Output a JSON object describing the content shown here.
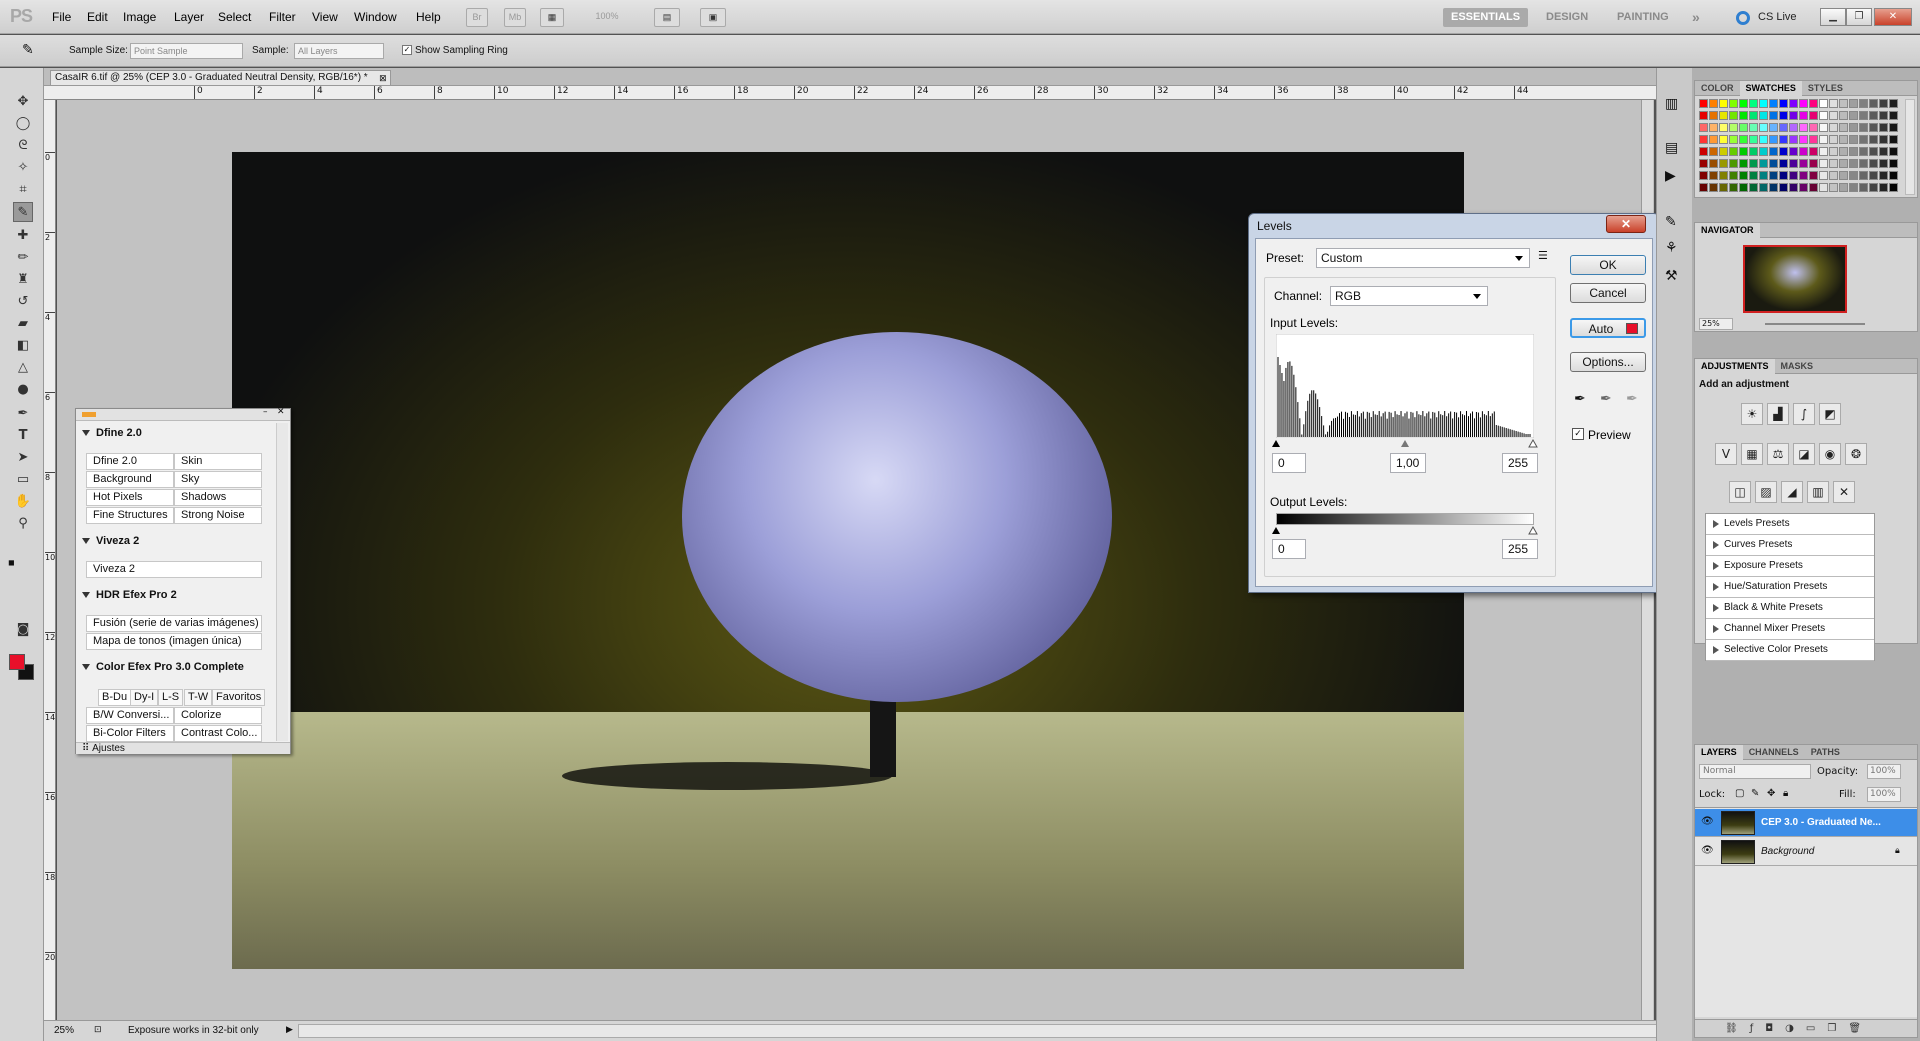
{
  "app": {
    "logo": "PS"
  },
  "menu": [
    "File",
    "Edit",
    "Image",
    "Layer",
    "Select",
    "Filter",
    "View",
    "Window",
    "Help"
  ],
  "menubar_buttons": {
    "br": "Br",
    "mb": "Mb",
    "zoom": "100%"
  },
  "workspaces": {
    "essentials": "ESSENTIALS",
    "design": "DESIGN",
    "painting": "PAINTING",
    "more": "»",
    "cslive": "CS Live"
  },
  "options": {
    "sample_size_label": "Sample Size:",
    "sample_size_value": "Point Sample",
    "sample_label": "Sample:",
    "sample_value": "All Layers",
    "show_ring_label": "Show Sampling Ring",
    "show_ring_checked": true
  },
  "document": {
    "tab_title": "CasaIR 6.tif @ 25% (CEP 3.0 - Graduated Neutral Density, RGB/16*) *",
    "ruler_top": [
      "0",
      "2",
      "4",
      "6",
      "8",
      "10",
      "12",
      "14",
      "16",
      "18",
      "20",
      "22",
      "24",
      "26",
      "28",
      "30",
      "32",
      "34",
      "36",
      "38",
      "40",
      "42",
      "44"
    ],
    "ruler_left": [
      "0",
      "2",
      "4",
      "6",
      "8",
      "10",
      "12",
      "14",
      "16",
      "18",
      "20"
    ],
    "zoom": "25%",
    "status": "Exposure works in 32-bit only"
  },
  "plugin_palette": {
    "dfine_header": "Dfine 2.0",
    "dfine_items": [
      "Dfine 2.0",
      "Skin",
      "Background",
      "Sky",
      "Hot Pixels",
      "Shadows",
      "Fine Structures",
      "Strong Noise"
    ],
    "viveza_header": "Viveza 2",
    "viveza_items": [
      "Viveza 2"
    ],
    "hdr_header": "HDR Efex Pro 2",
    "hdr_items": [
      "Fusión (serie de varias imágenes)",
      "Mapa de tonos (imagen única)"
    ],
    "cep_header": "Color Efex Pro 3.0 Complete",
    "cep_tabs": [
      "B-Du",
      "Dy-I",
      "L-S",
      "T-W",
      "Favoritos"
    ],
    "cep_items": [
      "B/W Conversi...",
      "Colorize",
      "Bi-Color Filters",
      "Contrast Colo..."
    ],
    "footer": "Ajustes"
  },
  "levels": {
    "title": "Levels",
    "close": "✕",
    "preset_label": "Preset:",
    "preset_value": "Custom",
    "channel_label": "Channel:",
    "channel_value": "RGB",
    "input_levels_label": "Input Levels:",
    "input_black": "0",
    "input_gamma": "1,00",
    "input_white": "255",
    "output_levels_label": "Output Levels:",
    "output_black": "0",
    "output_white": "255",
    "ok": "OK",
    "cancel": "Cancel",
    "auto": "Auto",
    "options": "Options...",
    "preview_label": "Preview",
    "preview_checked": true
  },
  "color_panel": {
    "tabs": [
      "COLOR",
      "SWATCHES",
      "STYLES"
    ],
    "active": "SWATCHES"
  },
  "navigator": {
    "tab": "NAVIGATOR",
    "zoom": "25%"
  },
  "adjustments": {
    "tabs": [
      "ADJUSTMENTS",
      "MASKS"
    ],
    "title": "Add an adjustment",
    "presets": [
      "Levels Presets",
      "Curves Presets",
      "Exposure Presets",
      "Hue/Saturation Presets",
      "Black & White Presets",
      "Channel Mixer Presets",
      "Selective Color Presets"
    ]
  },
  "layers": {
    "tabs": [
      "LAYERS",
      "CHANNELS",
      "PATHS"
    ],
    "blend_mode": "Normal",
    "opacity_label": "Opacity:",
    "opacity": "100%",
    "lock_label": "Lock:",
    "fill_label": "Fill:",
    "fill": "100%",
    "items": [
      {
        "name": "CEP 3.0 - Graduated Ne...",
        "selected": true
      },
      {
        "name": "Background",
        "selected": false
      }
    ]
  },
  "colors": {
    "foreground": "#e8102a",
    "background": "#111111",
    "selection": "#3d8ee8"
  }
}
